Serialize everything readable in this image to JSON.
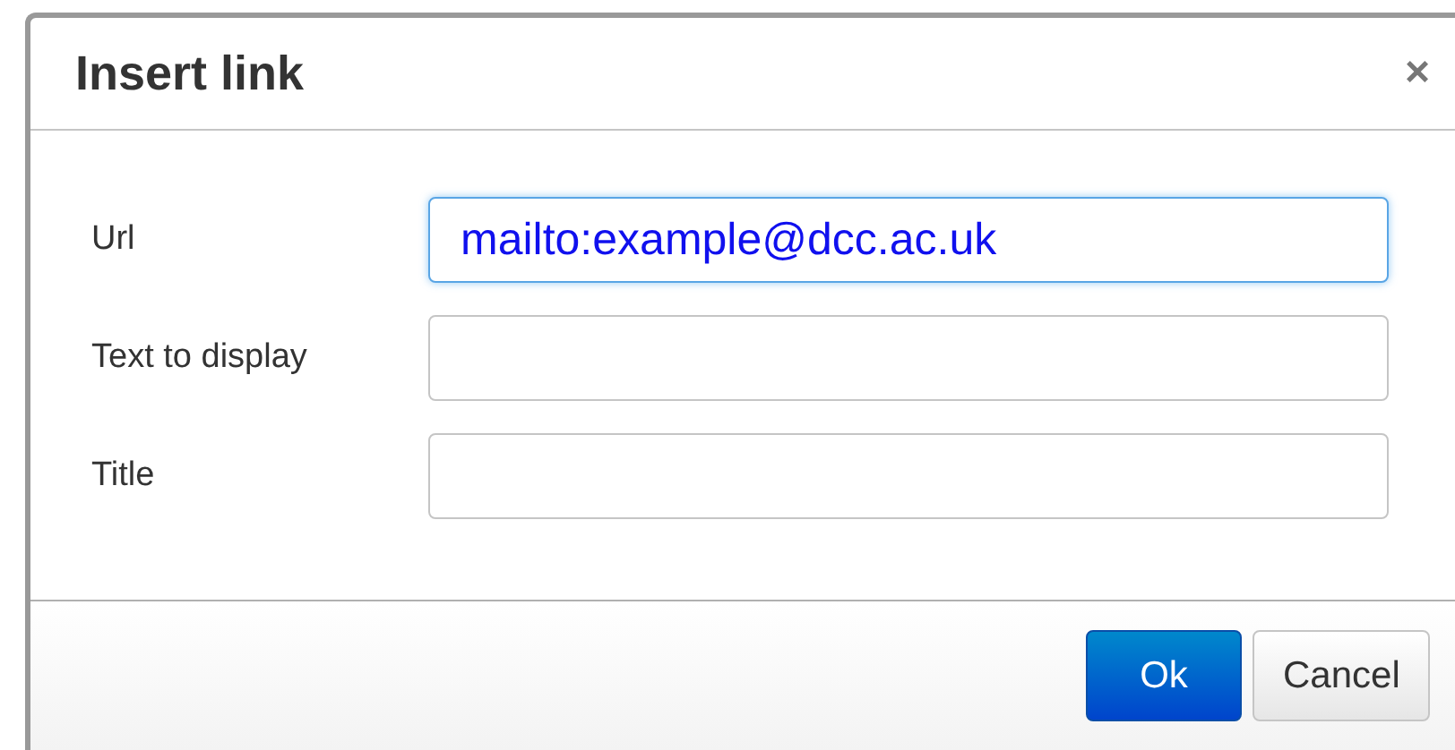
{
  "dialog": {
    "title": "Insert link",
    "close": "×"
  },
  "fields": [
    {
      "label": "Url",
      "value": "mailto:example@dcc.ac.uk",
      "focused": true
    },
    {
      "label": "Text to display",
      "focused": false
    },
    {
      "label": "Title",
      "focused": false
    }
  ],
  "buttons": [
    {
      "label": "Ok",
      "kind": "primary"
    },
    {
      "label": "Cancel",
      "kind": "default"
    }
  ]
}
